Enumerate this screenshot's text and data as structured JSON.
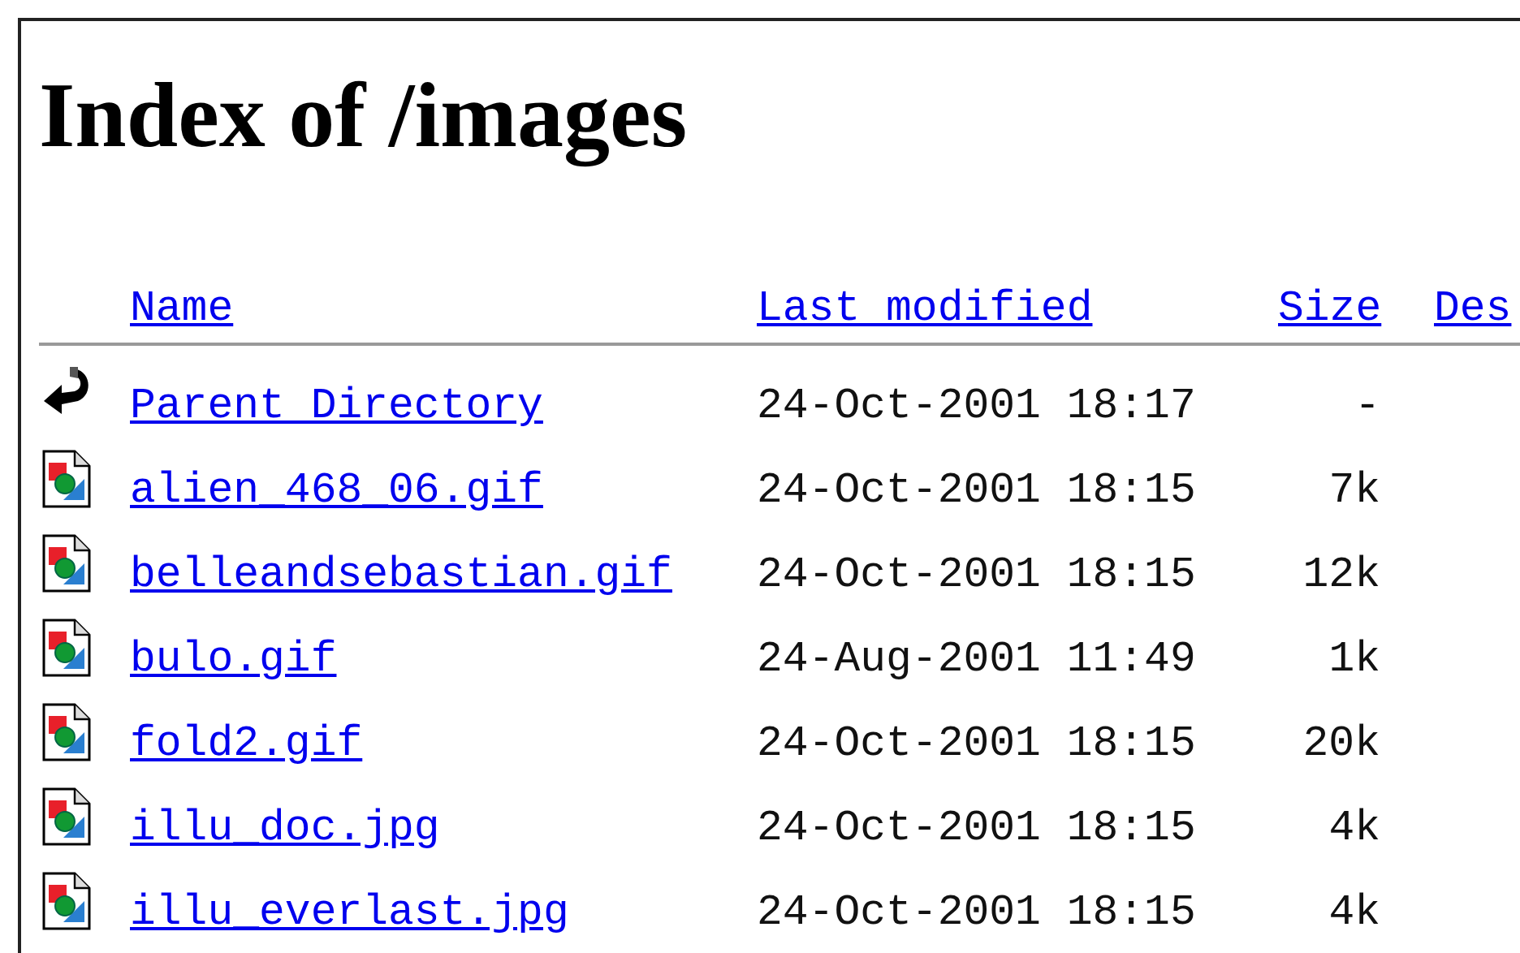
{
  "title": "Index of /images",
  "columns": [
    {
      "label": "Name"
    },
    {
      "label": "Last modified"
    },
    {
      "label": "Size"
    },
    {
      "label": "Des"
    }
  ],
  "rows": [
    {
      "kind": "parent",
      "name": "Parent Directory",
      "modified": "24-Oct-2001 18:17",
      "size": "-"
    },
    {
      "kind": "image",
      "name": "alien_468_06.gif",
      "modified": "24-Oct-2001 18:15",
      "size": "7k"
    },
    {
      "kind": "image",
      "name": "belleandsebastian.gif",
      "modified": "24-Oct-2001 18:15",
      "size": "12k"
    },
    {
      "kind": "image",
      "name": "bulo.gif",
      "modified": "24-Aug-2001 11:49",
      "size": "1k"
    },
    {
      "kind": "image",
      "name": "fold2.gif",
      "modified": "24-Oct-2001 18:15",
      "size": "20k"
    },
    {
      "kind": "image",
      "name": "illu_doc.jpg",
      "modified": "24-Oct-2001 18:15",
      "size": "4k"
    },
    {
      "kind": "image",
      "name": "illu_everlast.jpg",
      "modified": "24-Oct-2001 18:15",
      "size": "4k"
    }
  ]
}
